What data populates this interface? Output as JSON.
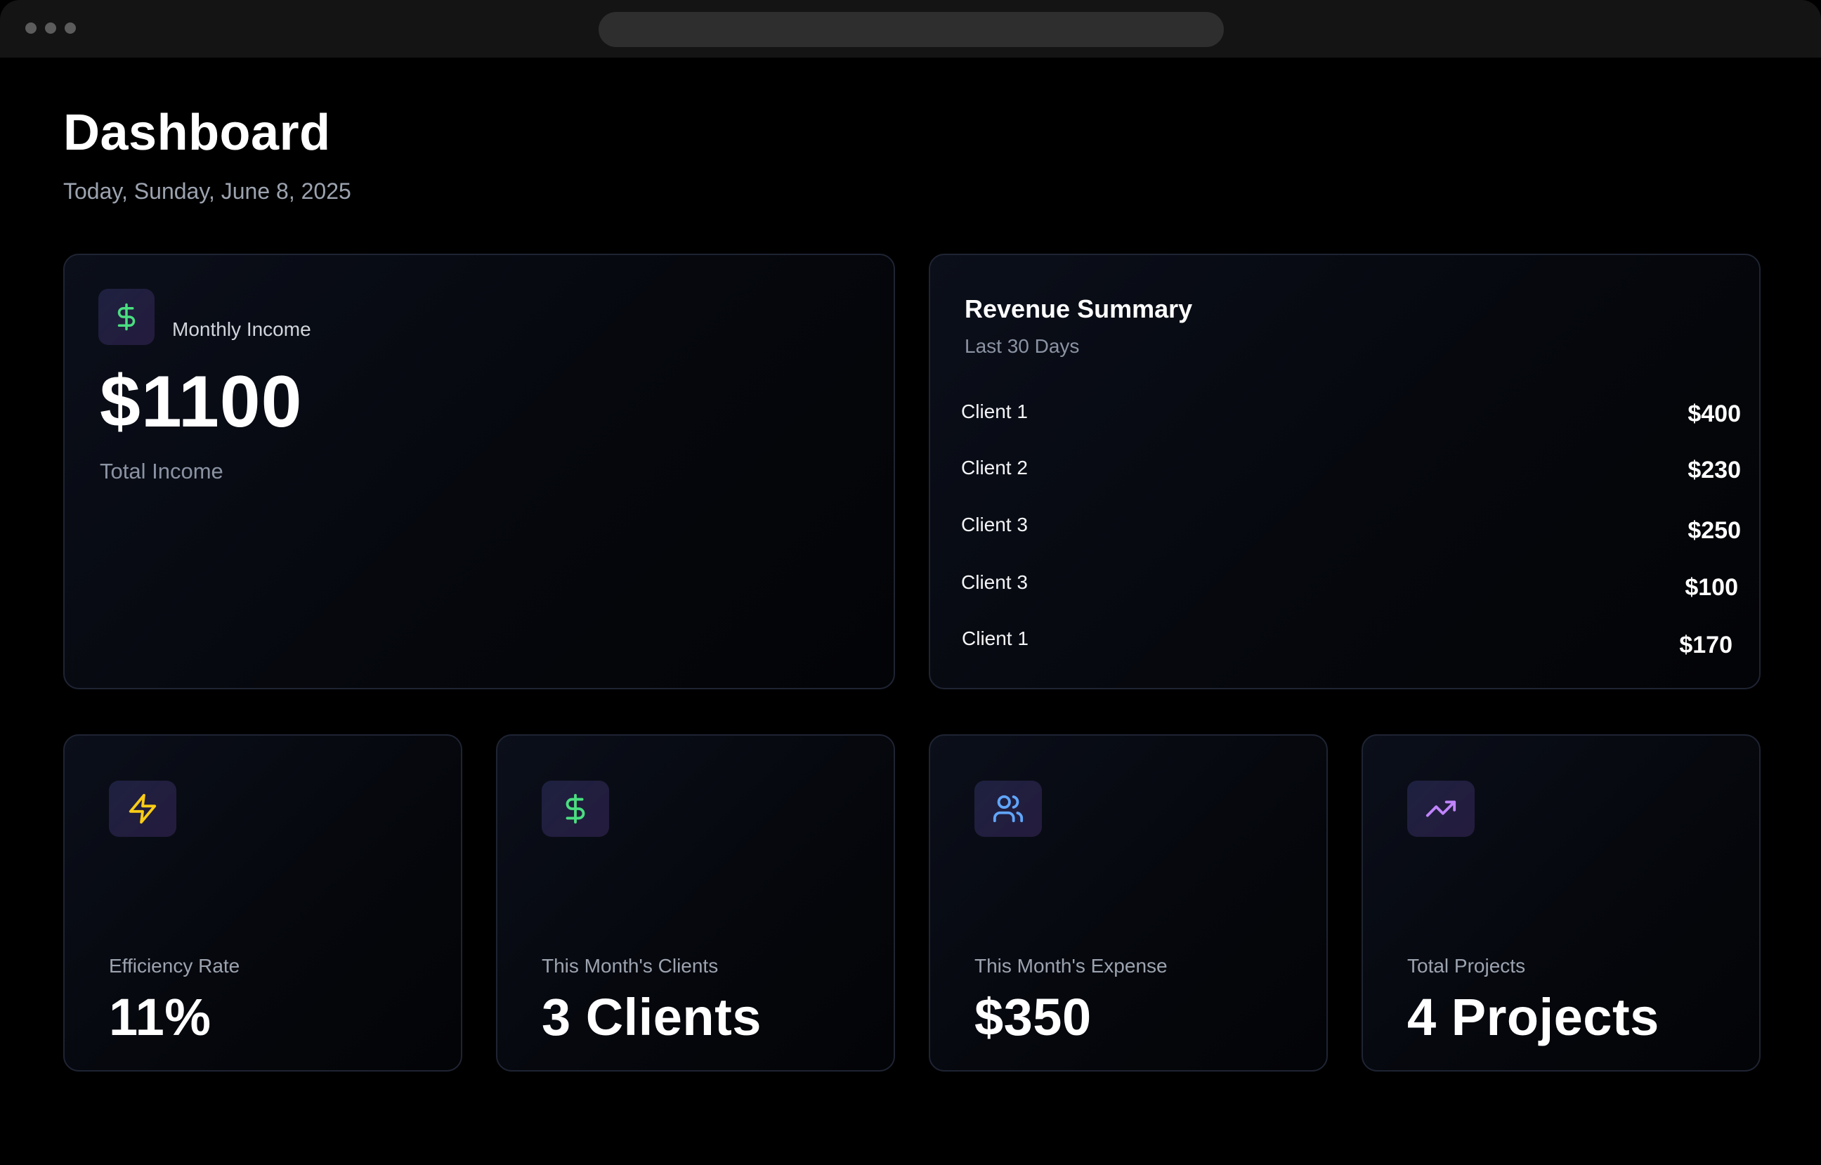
{
  "header": {
    "title": "Dashboard",
    "date": "Today, Sunday, June 8, 2025"
  },
  "income_card": {
    "icon": "dollar-icon",
    "label": "Monthly Income",
    "value": "$1100",
    "sub_label": "Total Income"
  },
  "revenue_summary": {
    "title": "Revenue Summary",
    "subtitle": "Last 30 Days",
    "rows": [
      {
        "client": "Client 1",
        "amount": "$400"
      },
      {
        "client": "Client 2",
        "amount": "$230"
      },
      {
        "client": "Client 3",
        "amount": "$250"
      },
      {
        "client": "Client 3",
        "amount": "$100"
      },
      {
        "client": "Client 1",
        "amount": "$170"
      }
    ]
  },
  "stats": [
    {
      "icon": "lightning-icon",
      "label": "Efficiency Rate",
      "value": "11%",
      "color": "#facc15"
    },
    {
      "icon": "dollar-icon",
      "label": "This Month's Clients",
      "value": "3 Clients",
      "color": "#4ade80"
    },
    {
      "icon": "users-icon",
      "label": "This Month's Expense",
      "value": "$350",
      "color": "#60a5fa"
    },
    {
      "icon": "trending-up-icon",
      "label": "Total Projects",
      "value": "4 Projects",
      "color": "#c084fc"
    }
  ],
  "colors": {
    "background": "#000000",
    "card_border": "#1f2433",
    "muted_text": "#9ca3af"
  }
}
